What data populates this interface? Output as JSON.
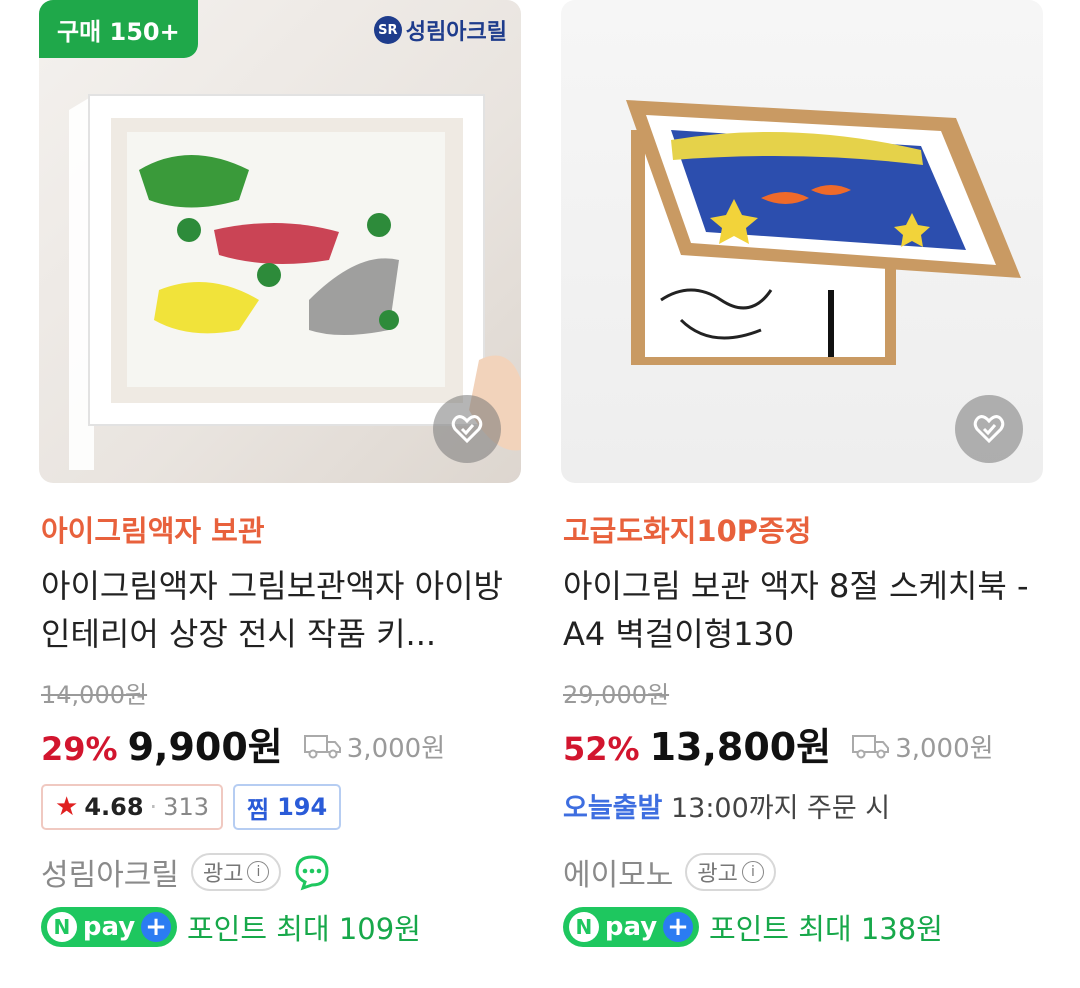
{
  "products": [
    {
      "badge": "구매 150+",
      "brand_logo_text": "성림아크릴",
      "brand_logo_mark": "SR",
      "promo": "아이그림액자 보관",
      "title": "아이그림액자 그림보관액자 아이방 인테리어 상장 전시 작품 키...",
      "original_price": "14,000원",
      "discount": "29%",
      "price": "9,900원",
      "shipping": "3,000원",
      "rating": "4.68",
      "review_count": "313",
      "jjim_label": "찜",
      "jjim_count": "194",
      "seller": "성림아크릴",
      "ad_label": "광고",
      "npay_text": "포인트 최대 109원"
    },
    {
      "promo": "고급도화지10P증정",
      "title": "아이그림 보관 액자 8절 스케치북 - A4 벽걸이형130",
      "original_price": "29,000원",
      "discount": "52%",
      "price": "13,800원",
      "shipping": "3,000원",
      "delivery_highlight": "오늘출발",
      "delivery_rest": "13:00까지 주문 시",
      "seller": "에이모노",
      "ad_label": "광고",
      "npay_text": "포인트 최대 138원"
    }
  ],
  "npay_logo_text": "pay",
  "icons": [
    "heart-icon",
    "truck-icon",
    "star-icon",
    "info-icon",
    "talk-icon",
    "npay-icon"
  ],
  "colors": {
    "promo": "#e8613c",
    "discount": "#d2152e",
    "badge": "#1fa84a",
    "npay": "#1ec75f",
    "today": "#3e6ee0"
  }
}
